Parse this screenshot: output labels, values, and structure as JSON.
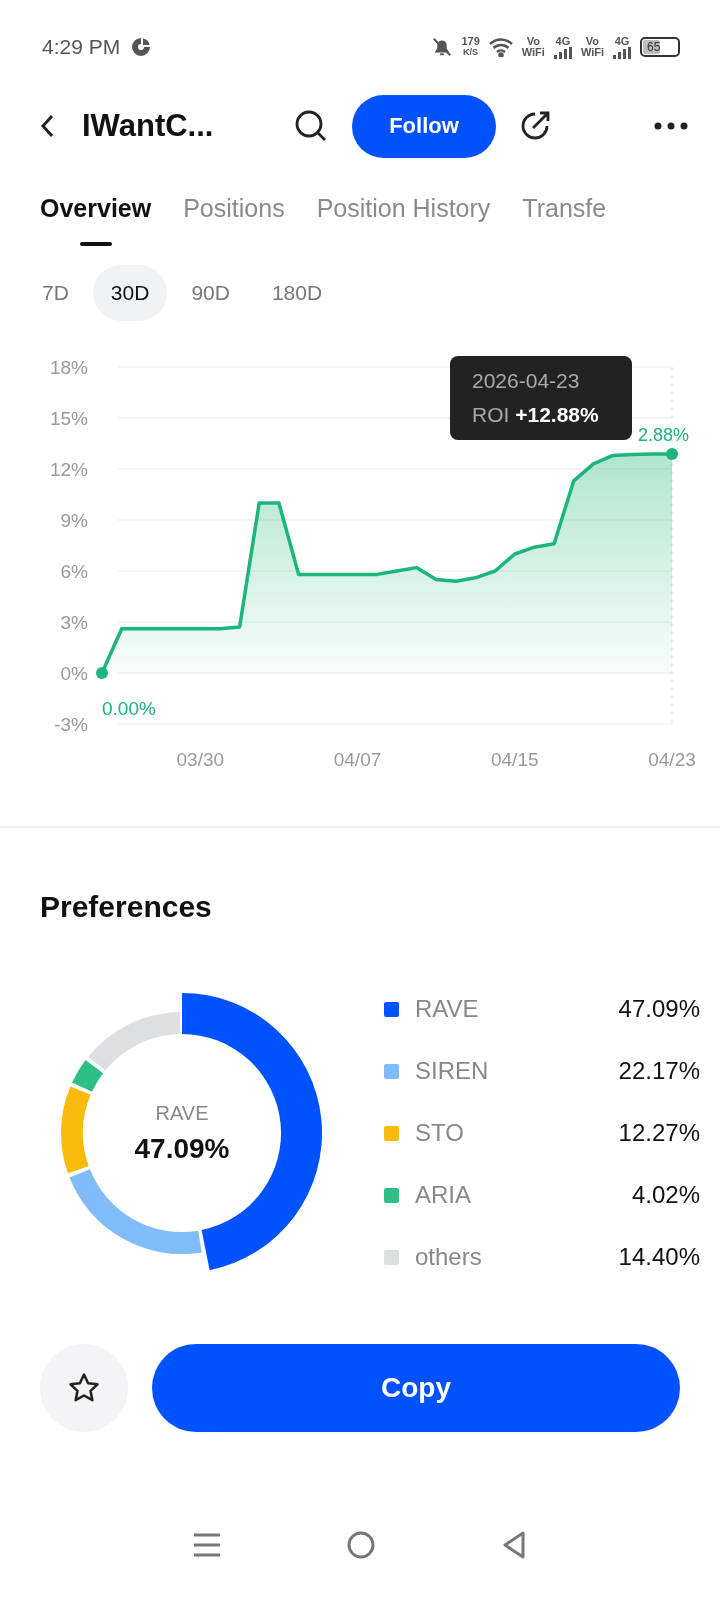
{
  "status_bar": {
    "time": "4:29 PM",
    "speed_value": "179",
    "speed_unit": "K/S",
    "sim1_label_top": "Vo",
    "sim1_label_bottom": "WiFi",
    "sim1_network": "4G",
    "sim2_label_top": "Vo",
    "sim2_label_bottom": "WiFi",
    "sim2_network": "4G",
    "battery": "65"
  },
  "header": {
    "title": "IWantC...",
    "follow_button": "Follow"
  },
  "tabs": [
    {
      "label": "Overview",
      "selected": true
    },
    {
      "label": "Positions",
      "selected": false
    },
    {
      "label": "Position History",
      "selected": false
    },
    {
      "label": "Transfe",
      "selected": false
    }
  ],
  "periods": [
    {
      "label": "7D",
      "selected": false
    },
    {
      "label": "30D",
      "selected": true
    },
    {
      "label": "90D",
      "selected": false
    },
    {
      "label": "180D",
      "selected": false
    }
  ],
  "roi_chart": {
    "start_label": "0.00%",
    "end_label": "2.88%",
    "tooltip": {
      "date": "2026-04-23",
      "metric": "ROI",
      "value": "+12.88%"
    },
    "chart_data": {
      "type": "area",
      "grid": true,
      "categories": [
        null,
        null,
        null,
        null,
        null,
        "03/30",
        null,
        null,
        null,
        null,
        null,
        null,
        null,
        "04/07",
        null,
        null,
        null,
        null,
        null,
        null,
        null,
        "04/15",
        null,
        null,
        null,
        null,
        null,
        null,
        null,
        "04/23"
      ],
      "series": [
        {
          "color": "#1db57a",
          "values": [
            0,
            2.6,
            2.6,
            2.6,
            2.6,
            2.6,
            2.6,
            2.7,
            10,
            10,
            5.8,
            5.8,
            5.8,
            5.8,
            5.8,
            6.0,
            6.2,
            5.5,
            5.4,
            5.6,
            6.0,
            7.0,
            7.4,
            7.6,
            11.3,
            12.3,
            12.8,
            12.85,
            12.88,
            12.88
          ]
        }
      ],
      "ylim": [
        -3,
        18
      ],
      "yticks": [
        {
          "value": 18,
          "label": "18%"
        },
        {
          "value": 15,
          "label": "15%"
        },
        {
          "value": 12,
          "label": "12%"
        },
        {
          "value": 9,
          "label": "9%"
        },
        {
          "value": 6,
          "label": "6%"
        },
        {
          "value": 3,
          "label": "3%"
        },
        {
          "value": 0,
          "label": "0%"
        },
        {
          "value": -3,
          "label": "-3%"
        }
      ]
    }
  },
  "preferences": {
    "title": "Preferences",
    "center_name": "RAVE",
    "center_value": "47.09%",
    "chart_data": {
      "type": "donut",
      "values": [
        47.09,
        22.17,
        12.27,
        4.02,
        14.4
      ]
    },
    "items": [
      {
        "name": "RAVE",
        "value": "47.09%",
        "color": "#0052ff"
      },
      {
        "name": "SIREN",
        "value": "22.17%",
        "color": "#80bcfa"
      },
      {
        "name": "STO",
        "value": "12.27%",
        "color": "#f8bb0b"
      },
      {
        "name": "ARIA",
        "value": "4.02%",
        "color": "#2fbe86"
      },
      {
        "name": "others",
        "value": "14.40%",
        "color": "#dedfe1"
      }
    ]
  },
  "copy_button": "Copy"
}
